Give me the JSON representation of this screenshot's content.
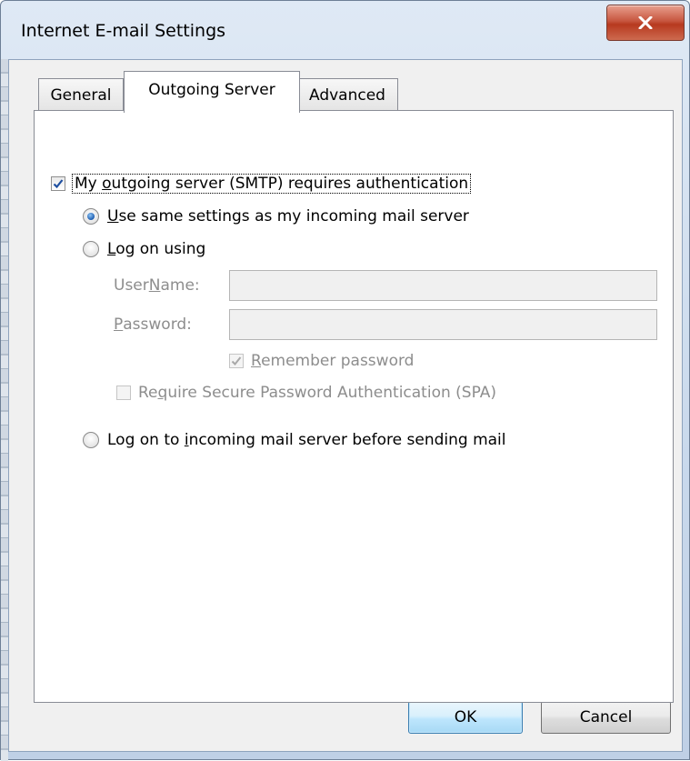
{
  "window": {
    "title": "Internet E-mail Settings",
    "close_symbol": "close-icon"
  },
  "tabs": [
    {
      "label": "General",
      "active": false
    },
    {
      "label": "Outgoing Server",
      "active": true
    },
    {
      "label": "Advanced",
      "active": false
    }
  ],
  "outgoing": {
    "requires_auth": {
      "checked": true,
      "label_pre": "My ",
      "label_ul": "o",
      "label_post": "utgoing server (SMTP) requires authentication"
    },
    "use_same": {
      "selected": true,
      "label_ul": "U",
      "label_post": "se same settings as my incoming mail server"
    },
    "log_on_using": {
      "selected": false,
      "label_ul": "L",
      "label_post": "og on using"
    },
    "user_name": {
      "label_pre": "User ",
      "label_ul": "N",
      "label_post": "ame:",
      "value": ""
    },
    "password": {
      "label_ul": "P",
      "label_post": "assword:",
      "value": ""
    },
    "remember_password": {
      "checked": true,
      "label_ul": "R",
      "label_post": "emember password"
    },
    "spa": {
      "checked": false,
      "label_pre": "Re",
      "label_ul": "q",
      "label_post": "uire Secure Password Authentication (SPA)"
    },
    "log_on_incoming": {
      "selected": false,
      "label_pre": "Log on to ",
      "label_ul": "i",
      "label_post": "ncoming mail server before sending mail"
    }
  },
  "buttons": {
    "ok": "OK",
    "cancel": "Cancel"
  },
  "colors": {
    "close_button": "#c7563f",
    "radio_selected": "#1c5cb0",
    "default_button_border": "#3c7fb1"
  }
}
